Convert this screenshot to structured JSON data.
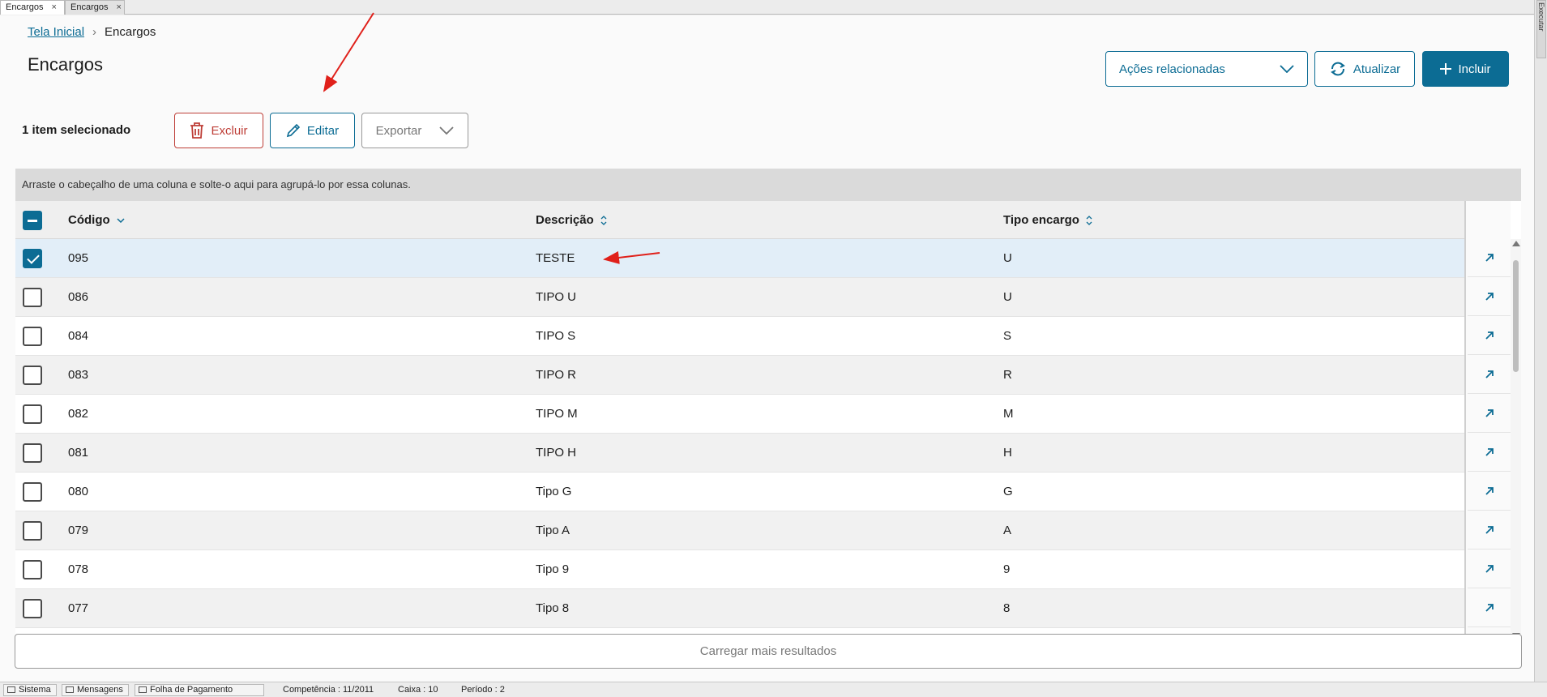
{
  "tabs": [
    {
      "label": "Encargos",
      "active": true
    },
    {
      "label": "Encargos",
      "active": false
    }
  ],
  "tab_close_glyph": "×",
  "side_tab": "Executar",
  "breadcrumb": {
    "home": "Tela Inicial",
    "separator": "›",
    "current": "Encargos"
  },
  "page_title": "Encargos",
  "header_actions": {
    "acoes": "Ações relacionadas",
    "atualizar": "Atualizar",
    "incluir": "Incluir"
  },
  "selection": {
    "count_label": "1 item selecionado"
  },
  "toolbar": {
    "excluir": "Excluir",
    "editar": "Editar",
    "exportar": "Exportar"
  },
  "grid": {
    "group_hint": "Arraste o cabeçalho de uma coluna e solte-o aqui para agrupá-lo por essa colunas.",
    "columns": {
      "codigo": "Código",
      "descricao": "Descrição",
      "tipo": "Tipo encargo"
    },
    "rows": [
      {
        "codigo": "095",
        "descricao": "TESTE",
        "tipo": "U",
        "selected": true
      },
      {
        "codigo": "086",
        "descricao": "TIPO U",
        "tipo": "U",
        "selected": false
      },
      {
        "codigo": "084",
        "descricao": "TIPO S",
        "tipo": "S",
        "selected": false
      },
      {
        "codigo": "083",
        "descricao": "TIPO R",
        "tipo": "R",
        "selected": false
      },
      {
        "codigo": "082",
        "descricao": "TIPO M",
        "tipo": "M",
        "selected": false
      },
      {
        "codigo": "081",
        "descricao": "TIPO H",
        "tipo": "H",
        "selected": false
      },
      {
        "codigo": "080",
        "descricao": "Tipo G",
        "tipo": "G",
        "selected": false
      },
      {
        "codigo": "079",
        "descricao": "Tipo A",
        "tipo": "A",
        "selected": false
      },
      {
        "codigo": "078",
        "descricao": "Tipo 9",
        "tipo": "9",
        "selected": false
      },
      {
        "codigo": "077",
        "descricao": "Tipo 8",
        "tipo": "8",
        "selected": false
      }
    ]
  },
  "load_more": "Carregar mais resultados",
  "statusbar": {
    "sistema": "Sistema",
    "mensagens": "Mensagens",
    "folha": "Folha de Pagamento",
    "competencia": "Competência : 11/2011",
    "caixa": "Caixa : 10",
    "periodo": "Período : 2"
  },
  "colors": {
    "accent": "#0c6c94",
    "danger": "#be3e37",
    "annotation": "#e0201a",
    "selected_row": "#e2eef8"
  }
}
